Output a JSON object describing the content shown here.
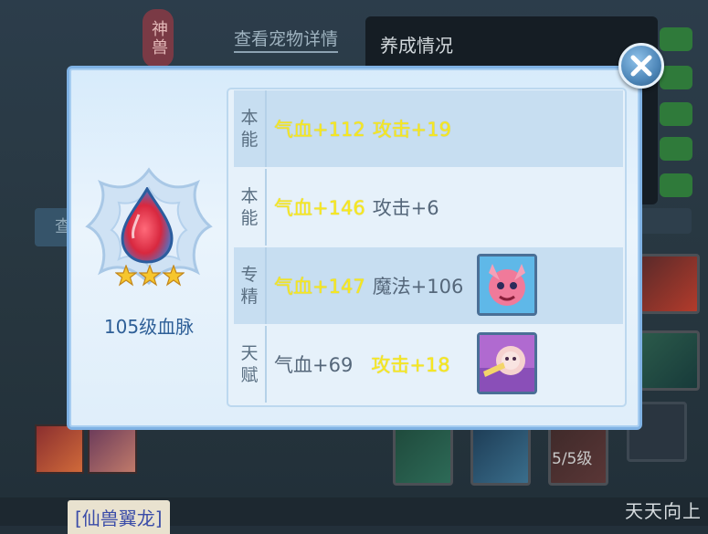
{
  "background": {
    "badge_text": "神兽",
    "view_detail_link": "查看宠物详情",
    "tip_title": "养成情况",
    "left_button_text": "查",
    "skill_level": "5/5级",
    "pet_name_tag": "[仙兽翼龙]",
    "corner_text": "天天向上"
  },
  "modal": {
    "level_label": "105级血脉",
    "star_count": 3,
    "rows": [
      {
        "label_line1": "本",
        "label_line2": "能",
        "stat1": "气血+112",
        "stat1_highlight": true,
        "stat2": "攻击+19",
        "stat2_highlight": true,
        "has_icon": false,
        "shaded": true
      },
      {
        "label_line1": "本",
        "label_line2": "能",
        "stat1": "气血+146",
        "stat1_highlight": true,
        "stat2": "攻击+6",
        "stat2_highlight": false,
        "has_icon": false,
        "shaded": false
      },
      {
        "label_line1": "专",
        "label_line2": "精",
        "stat1": "气血+147",
        "stat1_highlight": true,
        "stat2": "魔法+106",
        "stat2_highlight": false,
        "has_icon": true,
        "icon_name": "pink-beast-skill-icon",
        "shaded": true
      },
      {
        "label_line1": "天",
        "label_line2": "赋",
        "stat1": "气血+69",
        "stat1_highlight": false,
        "stat2": "攻击+18",
        "stat2_highlight": true,
        "has_icon": true,
        "icon_name": "purple-lion-skill-icon",
        "shaded": false
      }
    ]
  },
  "colors": {
    "highlight": "#f7e81f",
    "normal_text": "#55677a",
    "modal_border": "#7fb2e4",
    "level_text": "#2e5f97"
  }
}
